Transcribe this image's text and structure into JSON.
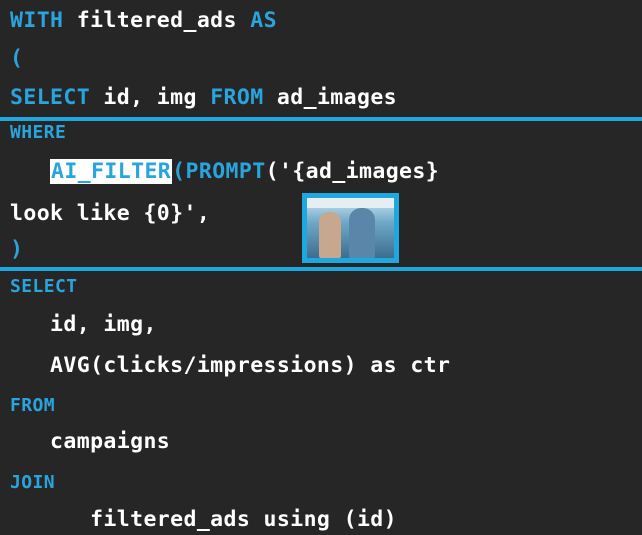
{
  "lines": {
    "l1a": "WITH",
    "l1b": " filtered_ads ",
    "l1c": "AS",
    "l2": "(",
    "l3a": "SELECT",
    "l3b": " id, img ",
    "l3c": "FROM",
    "l3d": " ad_images",
    "l4": "WHERE",
    "l5indent": "   ",
    "l5a": "AI_FILTER",
    "l5b": "(",
    "l5c": "PROMPT",
    "l5d": "('{ad_images}",
    "l6a": "look like {0}',",
    "l6b": " ))",
    "l7": ")",
    "l8": "SELECT",
    "l9": "   id, img,",
    "l10": "   AVG(clicks/impressions) as ctr",
    "l11": "FROM",
    "l12": "   campaigns",
    "l13": "JOIN",
    "l14": "      filtered_ads using (id)"
  },
  "colors": {
    "background": "#262626",
    "keyword": "#2aa4dc",
    "text": "#ffffff",
    "highlight": "#ffffff",
    "separator": "#1fa7e0"
  },
  "image_placeholder": {
    "icon": "ad-image-thumbnail"
  }
}
